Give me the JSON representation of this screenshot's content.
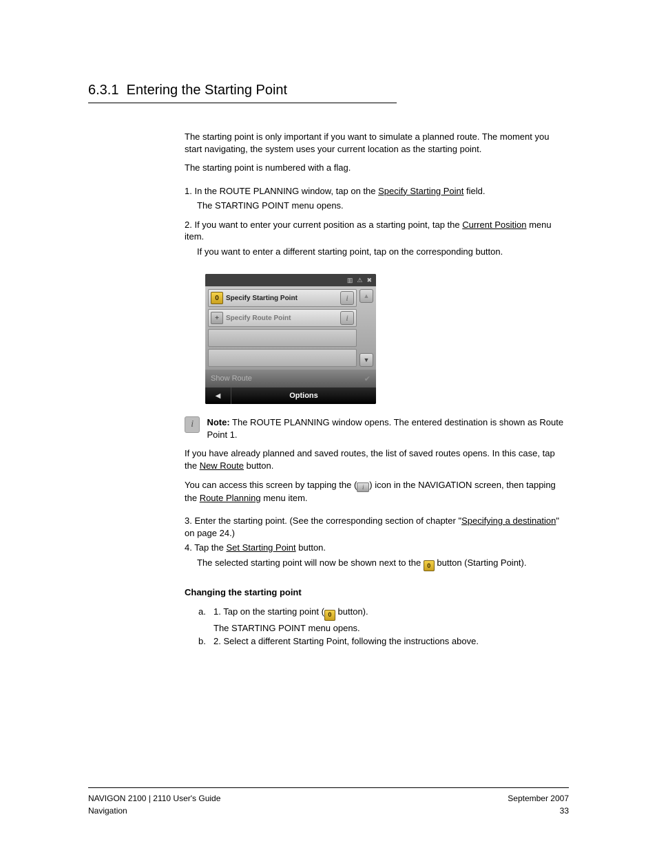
{
  "section": {
    "number": "6.3.1",
    "title": "Entering the Starting Point"
  },
  "intro1": "The starting point is only important if you want to simulate a planned route. The moment you start navigating, the system uses your current location as the starting point.",
  "intro2": "The starting point is numbered with a flag.",
  "steps": {
    "s1_a": "1. In the R",
    "s1_b": "OUTE ",
    "s1_c": "P",
    "s1_d": "LANNING",
    "s1_e": " window, tap on the ",
    "s1_link": "Specify Starting Point",
    "s1_f": " field.",
    "s1_sub_a": "The S",
    "s1_sub_b": "TARTING ",
    "s1_sub_c": "P",
    "s1_sub_d": "OINT",
    "s1_sub_e": " menu opens.",
    "s2": "2. If you want to enter your current position as a starting point, tap the ",
    "s2_link": "Current Position",
    "s2_b": " menu item.",
    "s2_sub": "If you want to enter a different starting point, tap on the corresponding button.",
    "s3": "3. Enter the starting point. (See the corresponding section of chapter \"",
    "s3_link": "Specifying a destination",
    "s3_b": "\" on page 24.)",
    "s4": "4. Tap the ",
    "s4_link": "Set Starting Point",
    "s4_b": " button.",
    "s4_sub_a": "The selected starting point will now be shown next to the ",
    "s4_sub_b": " button (Starting Point)."
  },
  "device": {
    "row0_marker": "0",
    "row0_label": "Specify Starting Point",
    "row1_marker": "+",
    "row1_label": "Specify Route Point",
    "showroute": "Show Route",
    "options": "Options"
  },
  "note": {
    "lead": "Note:",
    "text": " The ROUTE PLANNING window opens. The entered destination is shown as Route Point 1.",
    "icon": "i"
  },
  "para_after": "If you have already planned and saved routes, the list of saved routes opens. In this case, tap the ",
  "para_after_link": "New Route",
  "para_after_b": " button.",
  "iconline": {
    "a": "You can access this screen by tapping the (",
    "b": ") icon in the N",
    "c": "AVIGATION",
    "d": " screen, then tapping the ",
    "link": "Route Planning",
    "e": " menu item.",
    "icon": "i"
  },
  "change": {
    "title": "Changing the starting point",
    "p1a": "1. Tap on the starting point (",
    "p1b": " button).",
    "sub_a": "The S",
    "sub_b": "TARTING ",
    "sub_c": "P",
    "sub_d": "OINT",
    "sub_e": " menu opens.",
    "p2": "2. Select a different Starting Point, following the instructions above.",
    "marker": "0"
  },
  "footer": {
    "left": "NAVIGON 2100 | 2110 User's Guide",
    "right": "September 2007",
    "pageleft": "Navigation",
    "pageright": "33"
  }
}
